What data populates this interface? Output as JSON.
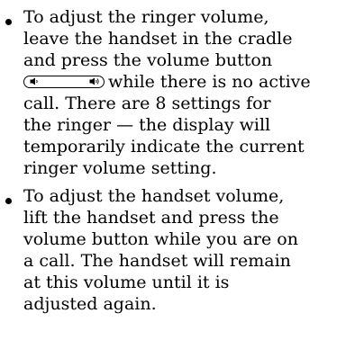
{
  "bullets": [
    {
      "lines": [
        "To adjust the ringer volume,",
        "leave the handset in the cradle",
        "and press the volume button",
        "while there is no active",
        "call. There are 8 settings for",
        "the ringer — the display will",
        "temporarily indicate the current",
        "ringer volume setting."
      ],
      "inline_icon": "volume-button-icon"
    },
    {
      "lines": [
        "To adjust the handset volume,",
        "lift the handset and press the",
        "volume button while you are on",
        "a call. The handset will remain",
        "at this volume until it is",
        "adjusted again."
      ]
    }
  ]
}
